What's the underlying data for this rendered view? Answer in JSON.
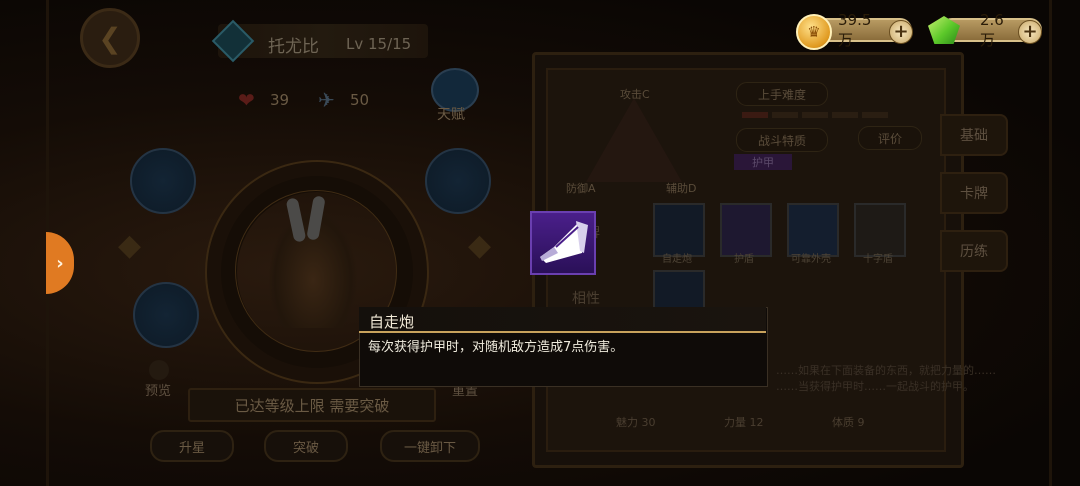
{
  "currency": {
    "gold": {
      "value": "39.5万",
      "icon": "gold-coin-icon"
    },
    "gems": {
      "value": "2.6万",
      "icon": "green-gem-icon"
    }
  },
  "hero": {
    "name": "托尤比",
    "level": "Lv 15/15",
    "hearts": "39",
    "wings": "50",
    "talent_label": "天赋",
    "preview_label": "预览",
    "reset_label": "重置",
    "level_banner": "已达等级上限 需要突破",
    "buttons": {
      "star_up": "升星",
      "breakthrough": "突破",
      "unequip_all": "一键卸下"
    }
  },
  "info_panel": {
    "triangle": {
      "top": "攻击C",
      "left": "防御A",
      "right": "辅助D"
    },
    "difficulty_label": "上手难度",
    "battle_trait_label": "战斗特质",
    "review_button": "评价",
    "armor_tag": "护甲",
    "section_cards": "卡牌",
    "section_fav": "相性",
    "cards": [
      "自走炮",
      "护盾",
      "可靠外壳",
      "十字盾"
    ],
    "bottom_stats": [
      "魅力 30",
      "力量 12",
      "体质 9"
    ],
    "desc_line1": "……如果在下面装备的东西，就把力量的……",
    "desc_line2": "……当获得护甲时……一起战斗的护甲。"
  },
  "side_tabs": [
    "基础",
    "卡牌",
    "历练"
  ],
  "tooltip": {
    "title": "自走炮",
    "description": "每次获得护甲时，对随机敌方造成7点伤害。",
    "icon": "megaphone-icon"
  },
  "colors": {
    "accent_orange": "#e07a22",
    "tooltip_gold_line": "#c8a25c",
    "skill_icon_purple": "#4a1f8a"
  }
}
